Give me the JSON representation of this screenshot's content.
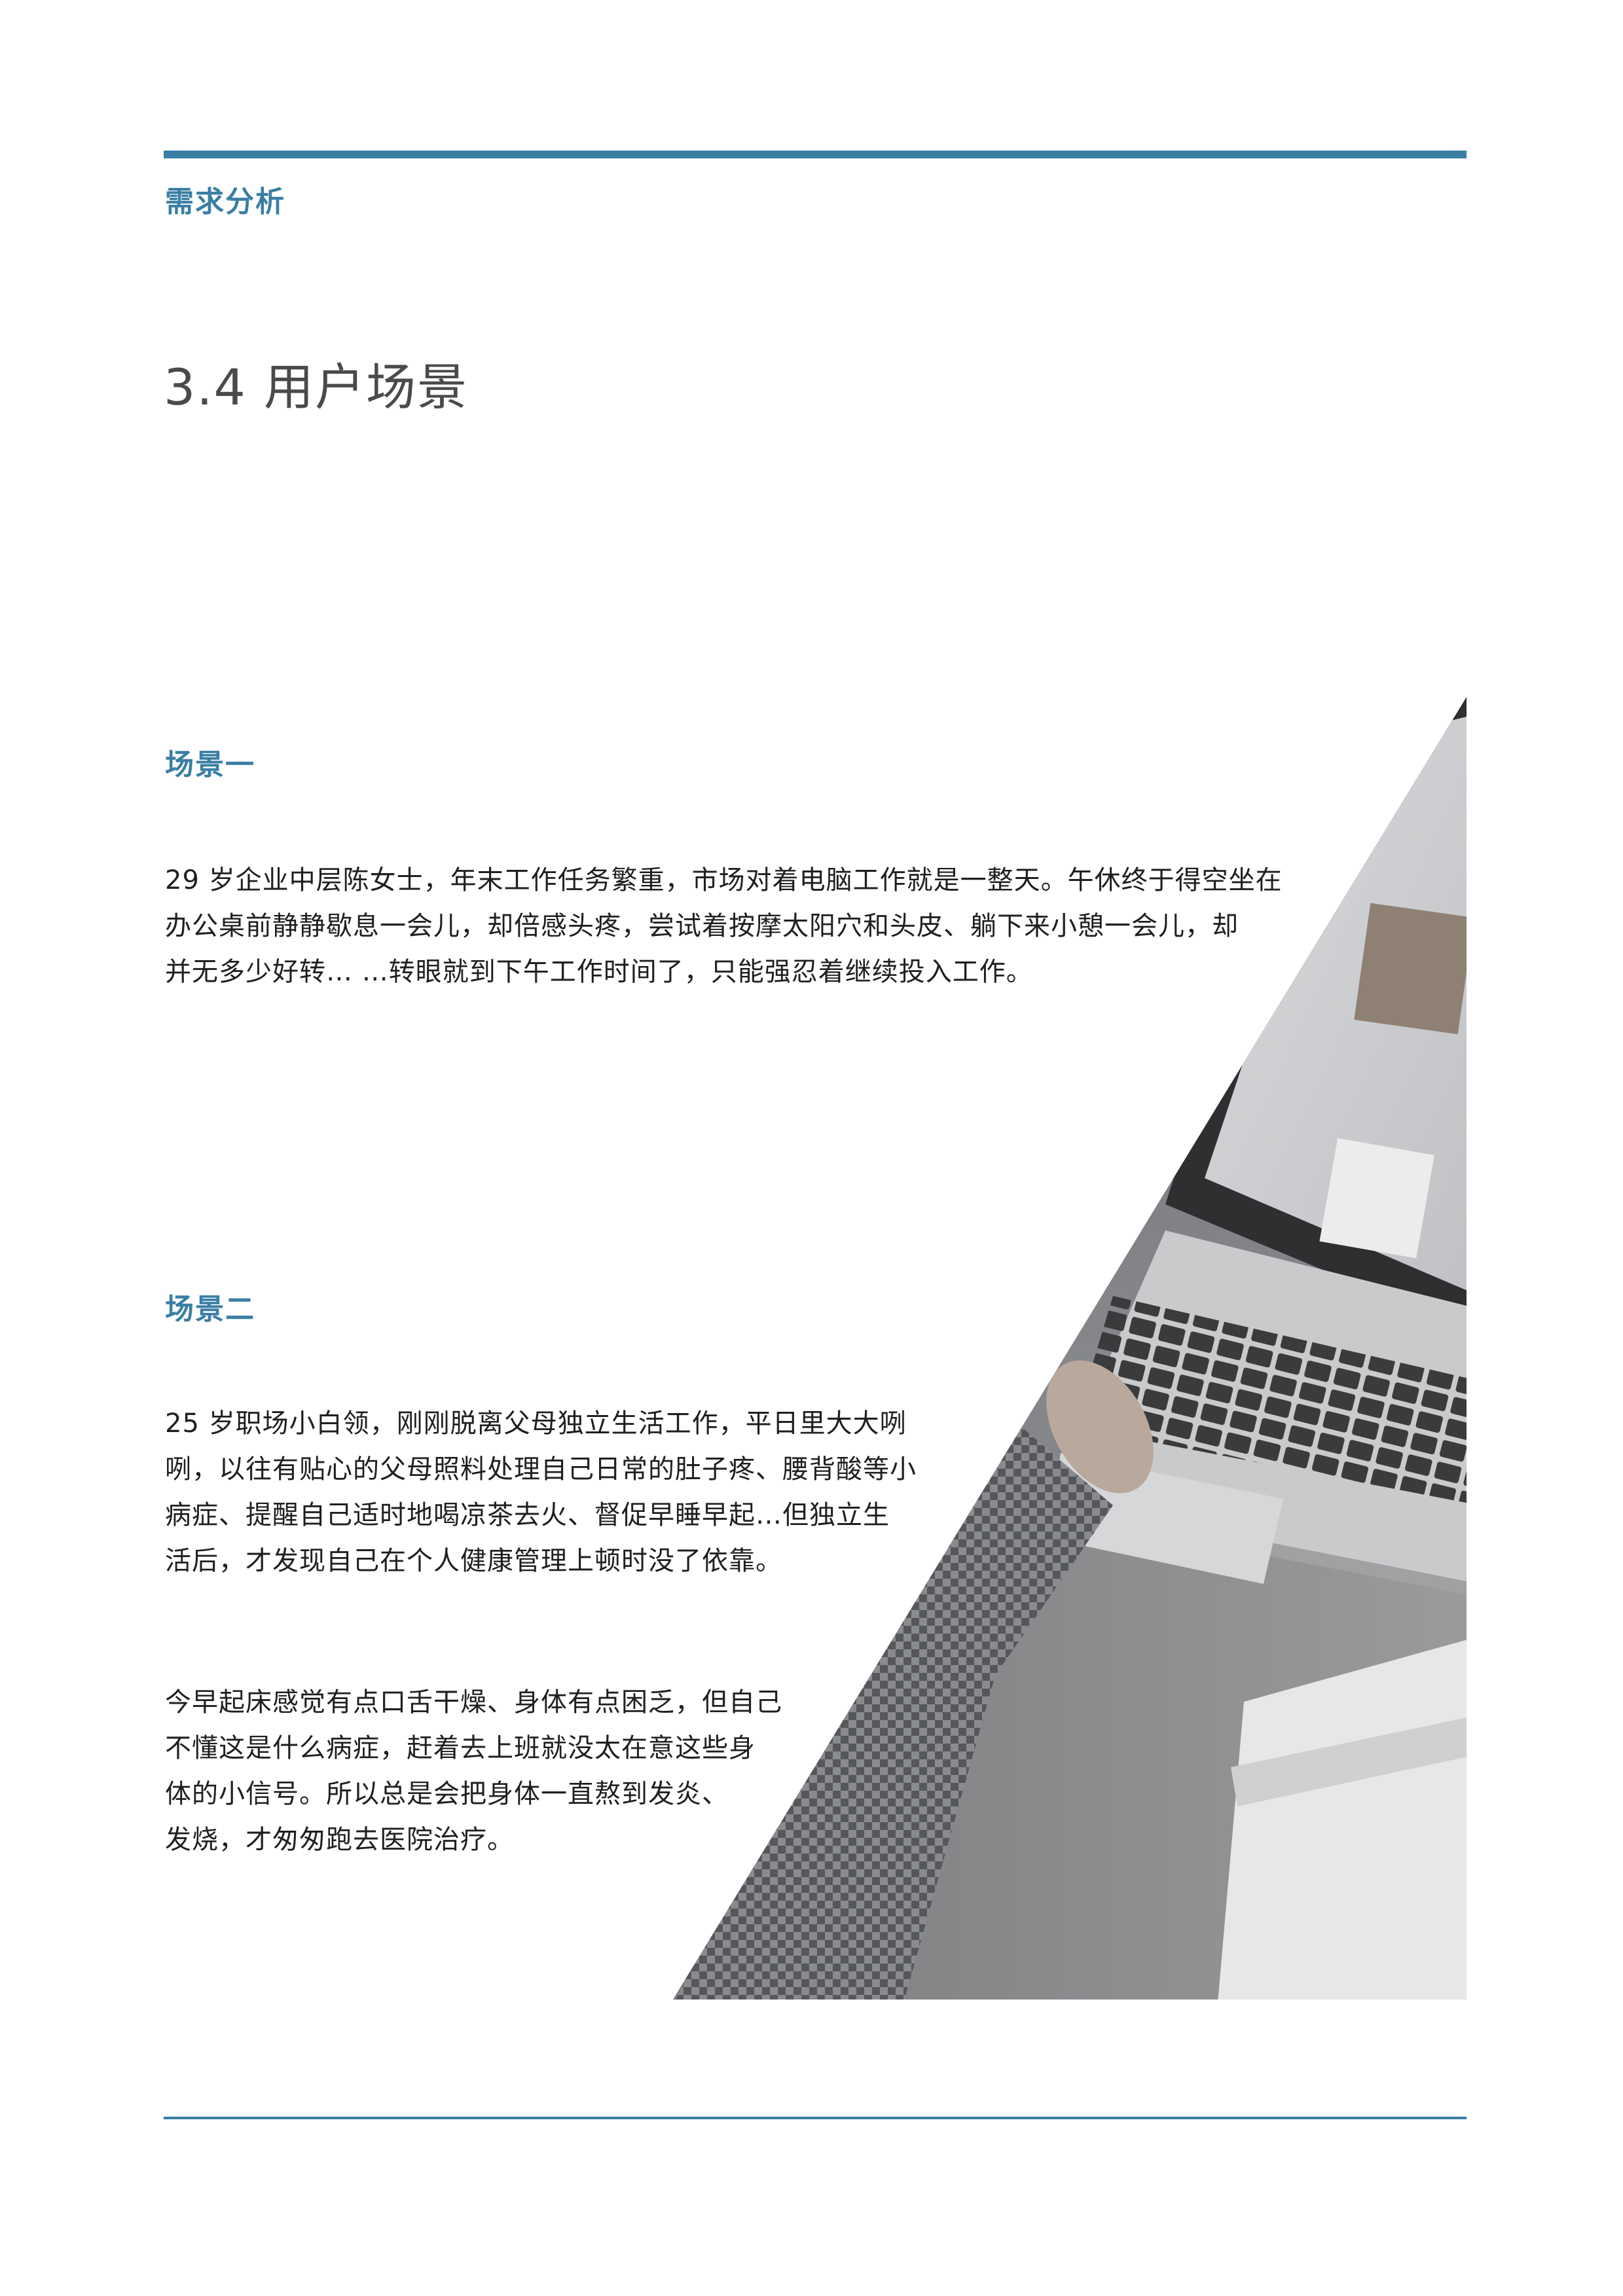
{
  "header": {
    "section_label": "需求分析"
  },
  "title": "3.4 用户场景",
  "scenes": [
    {
      "heading": "场景一",
      "paragraphs": [
        [
          "29 岁企业中层陈女士，年末工作任务繁重，市场对着电脑工作就是一整天。午休终于得空坐在",
          "办公桌前静静歇息一会儿，却倍感头疼，尝试着按摩太阳穴和头皮、躺下来小憩一会儿，却",
          "并无多少好转… …转眼就到下午工作时间了，只能强忍着继续投入工作。"
        ]
      ]
    },
    {
      "heading": "场景二",
      "paragraphs": [
        [
          "25 岁职场小白领，刚刚脱离父母独立生活工作，平日里大大咧",
          "咧，以往有贴心的父母照料处理自己日常的肚子疼、腰背酸等小",
          "病症、提醒自己适时地喝凉茶去火、督促早睡早起…但独立生",
          "活后，才发现自己在个人健康管理上顿时没了依靠。"
        ],
        [
          "今早起床感觉有点口舌干燥、身体有点困乏，但自己",
          "不懂这是什么病症，赶着去上班就没太在意这些身",
          "体的小信号。所以总是会把身体一直熬到发炎、",
          "发烧，才匆匆跑去医院治疗。"
        ]
      ]
    }
  ],
  "colors": {
    "accent": "#3a7ea4",
    "title_gray": "#4a4a4a"
  }
}
